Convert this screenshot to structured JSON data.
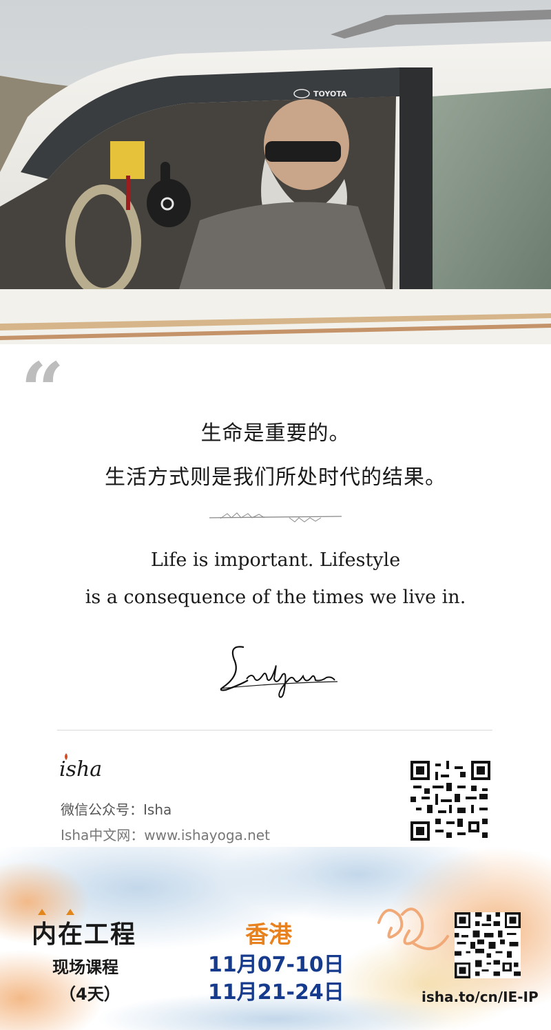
{
  "quote": {
    "mark": "“",
    "zh_line1": "生命是重要的。",
    "zh_line2": "生活方式则是我们所处时代的结果。",
    "en_line1": "Life is important. Lifestyle",
    "en_line2": "is a consequence of the times we live in."
  },
  "signature": "Sadhguru",
  "footer": {
    "logo": "isha",
    "wechat": "微信公众号：Isha",
    "website": "Isha中文网：www.ishayoga.net"
  },
  "program": {
    "title": "内在工程",
    "subtitle": "现场课程",
    "days": "（4天）",
    "city": "香港",
    "date1": "11月07-10日",
    "date2": "11月21-24日",
    "url": "isha.to/cn/IE-IP"
  },
  "colors": {
    "accent_orange": "#e8821f",
    "date_blue": "#163a8c",
    "quote_mark_gray": "#bdbdbd"
  },
  "icons": [
    "quote-icon",
    "qr-code-icon",
    "isha-logo"
  ]
}
